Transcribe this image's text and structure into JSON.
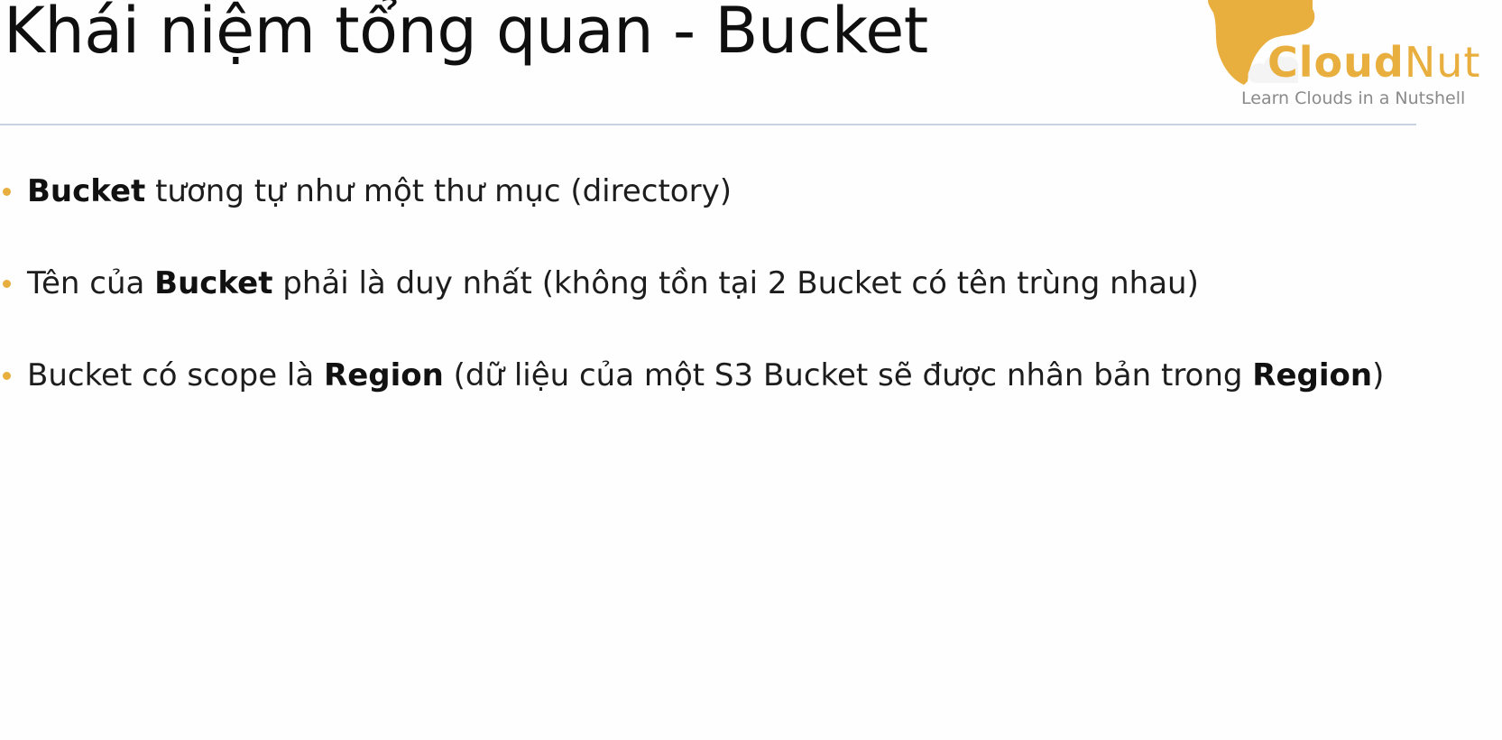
{
  "slide": {
    "title": "Khái niệm tổng quan - Bucket"
  },
  "logo": {
    "brand_bold": "Cloud",
    "brand_light": "Nut",
    "tagline": "Learn Clouds in a Nutshell",
    "accent_color": "#e8ae3e"
  },
  "bullets": [
    {
      "b1": "Bucket",
      "t1": " tương tự như một thư mục (directory)"
    },
    {
      "t0": "Tên của ",
      "b1": "Bucket",
      "t1": " phải là duy nhất (không tồn tại 2 Bucket có tên trùng nhau)"
    },
    {
      "t0": "Bucket có scope là ",
      "b1": "Region",
      "t1": " (dữ liệu của một S3 Bucket sẽ được nhân bản trong ",
      "b2": "Region",
      "t2": ")"
    }
  ]
}
